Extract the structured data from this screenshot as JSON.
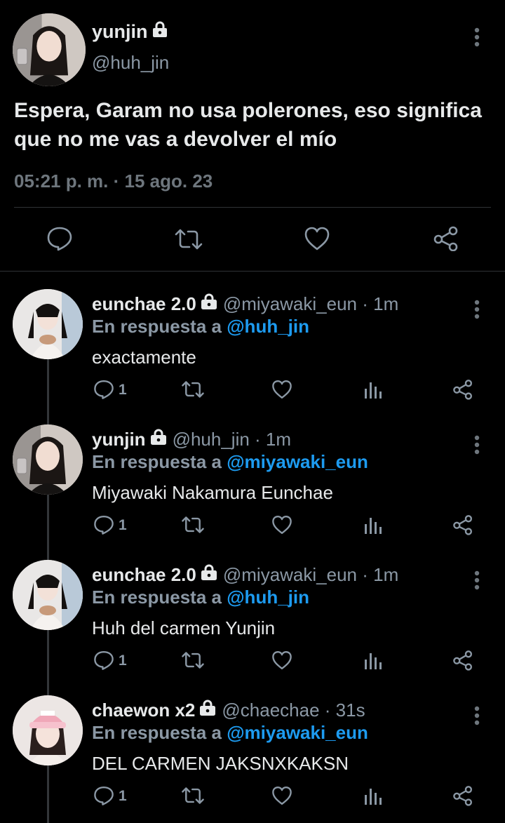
{
  "main_tweet": {
    "name": "yunjin",
    "handle": "@huh_jin",
    "text": "Espera, Garam no usa polerones, eso significa que no me vas a devolver el mío",
    "timestamp": "05:21 p. m. · 15 ago. 23",
    "actions": [
      "reply-icon",
      "retweet-icon",
      "like-icon",
      "share-icon"
    ]
  },
  "replies": [
    {
      "name": "eunchae 2.0",
      "handle": "@miyawaki_eun · 1m",
      "reply_prefix": "En respuesta a ",
      "reply_to": "@huh_jin",
      "text": "exactamente",
      "reply_count": "1"
    },
    {
      "name": "yunjin",
      "handle": "@huh_jin · 1m",
      "reply_prefix": "En respuesta a ",
      "reply_to": "@miyawaki_eun",
      "text": "Miyawaki Nakamura Eunchae",
      "reply_count": "1"
    },
    {
      "name": "eunchae 2.0",
      "handle": "@miyawaki_eun · 1m",
      "reply_prefix": "En respuesta a ",
      "reply_to": "@huh_jin",
      "text": "Huh del carmen Yunjin",
      "reply_count": "1"
    },
    {
      "name": "chaewon x2",
      "handle": "@chaechae · 31s",
      "reply_prefix": "En respuesta a ",
      "reply_to": "@miyawaki_eun",
      "text": "DEL CARMEN JAKSNXKAKSN",
      "reply_count": "1"
    }
  ],
  "colors": {
    "background": "#000000",
    "text": "#e7e9ea",
    "secondary": "#8b98a5",
    "mention": "#1d9bf0",
    "divider": "#2f3336"
  }
}
